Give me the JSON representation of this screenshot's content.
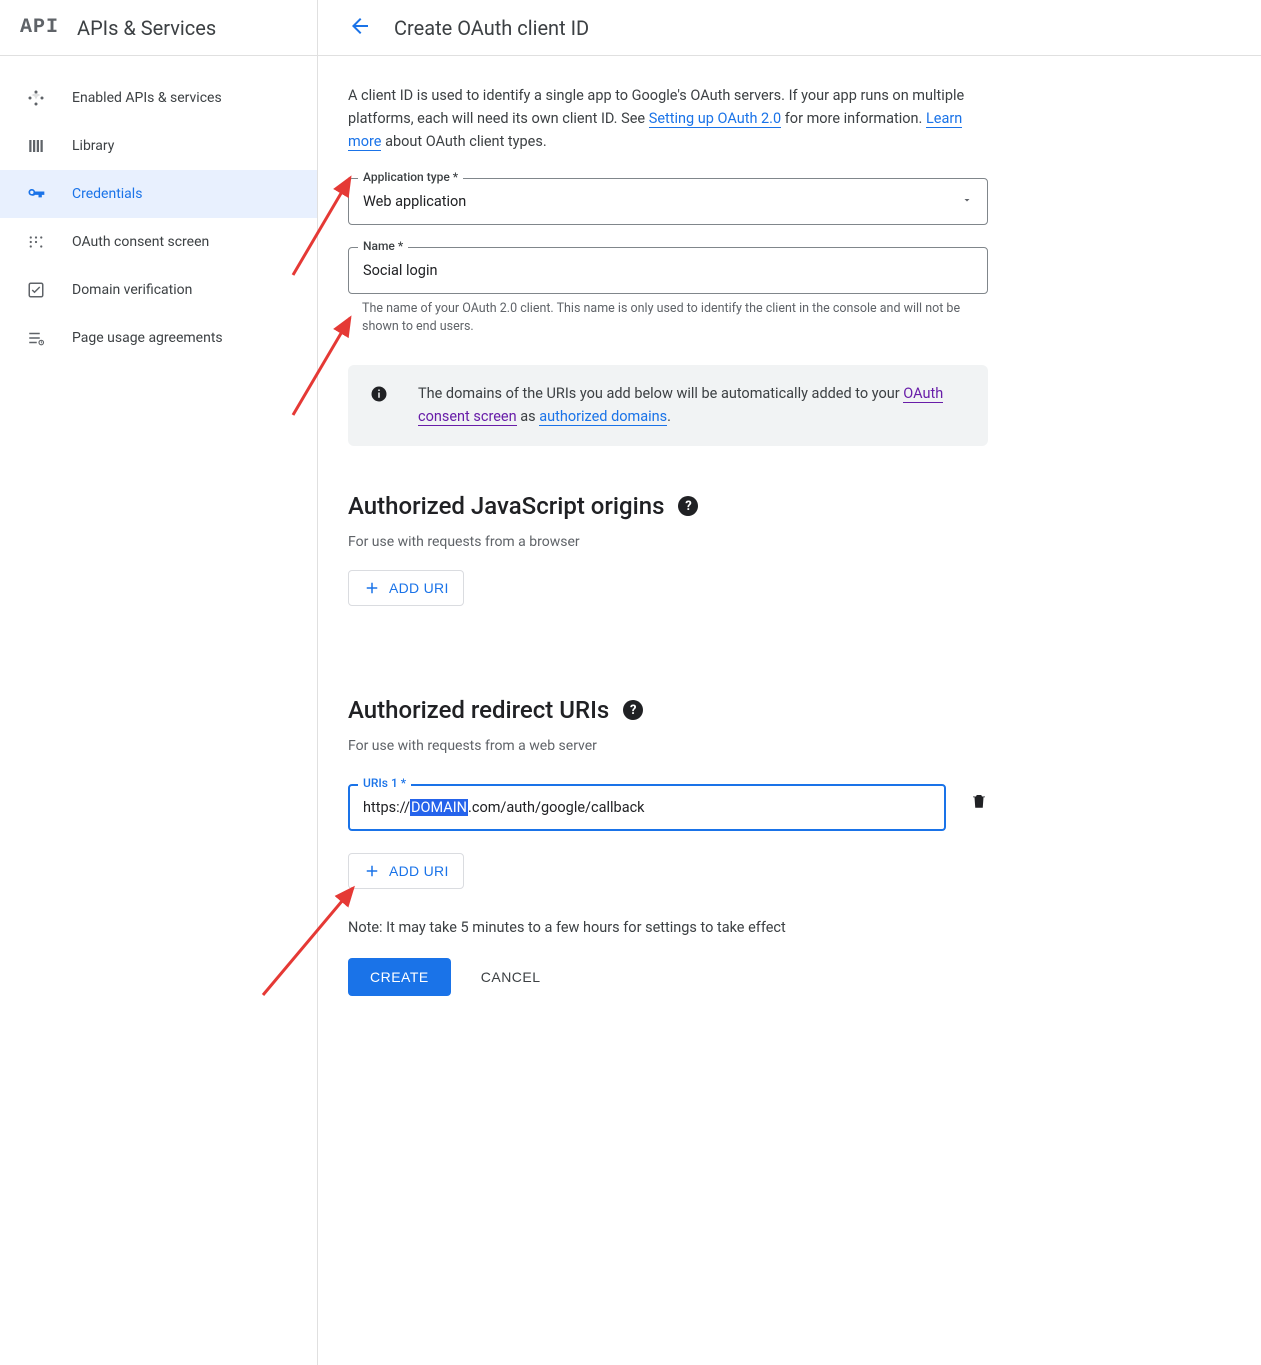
{
  "sidebar": {
    "logo": "API",
    "title": "APIs & Services",
    "items": [
      {
        "label": "Enabled APIs & services"
      },
      {
        "label": "Library"
      },
      {
        "label": "Credentials"
      },
      {
        "label": "OAuth consent screen"
      },
      {
        "label": "Domain verification"
      },
      {
        "label": "Page usage agreements"
      }
    ]
  },
  "header": {
    "title": "Create OAuth client ID"
  },
  "intro": {
    "part1": "A client ID is used to identify a single app to Google's OAuth servers. If your app runs on multiple platforms, each will need its own client ID. See ",
    "link1": "Setting up OAuth 2.0",
    "part2": " for more information. ",
    "link2": "Learn more",
    "part3": " about OAuth client types."
  },
  "form": {
    "appType": {
      "label": "Application type *",
      "value": "Web application"
    },
    "name": {
      "label": "Name *",
      "value": "Social login",
      "helper": "The name of your OAuth 2.0 client. This name is only used to identify the client in the console and will not be shown to end users."
    }
  },
  "banner": {
    "part1": "The domains of the URIs you add below will be automatically added to your ",
    "link1": "OAuth consent screen",
    "mid": " as ",
    "link2": "authorized domains",
    "end": "."
  },
  "jsOrigins": {
    "title": "Authorized JavaScript origins",
    "desc": "For use with requests from a browser",
    "addBtn": "ADD URI"
  },
  "redirect": {
    "title": "Authorized redirect URIs",
    "desc": "For use with requests from a web server",
    "uri1": {
      "label": "URIs 1 *",
      "pre": "https://",
      "sel": "DOMAIN",
      "post": ".com/auth/google/callback"
    },
    "addBtn": "ADD URI"
  },
  "note": "Note: It may take 5 minutes to a few hours for settings to take effect",
  "actions": {
    "create": "CREATE",
    "cancel": "CANCEL"
  }
}
